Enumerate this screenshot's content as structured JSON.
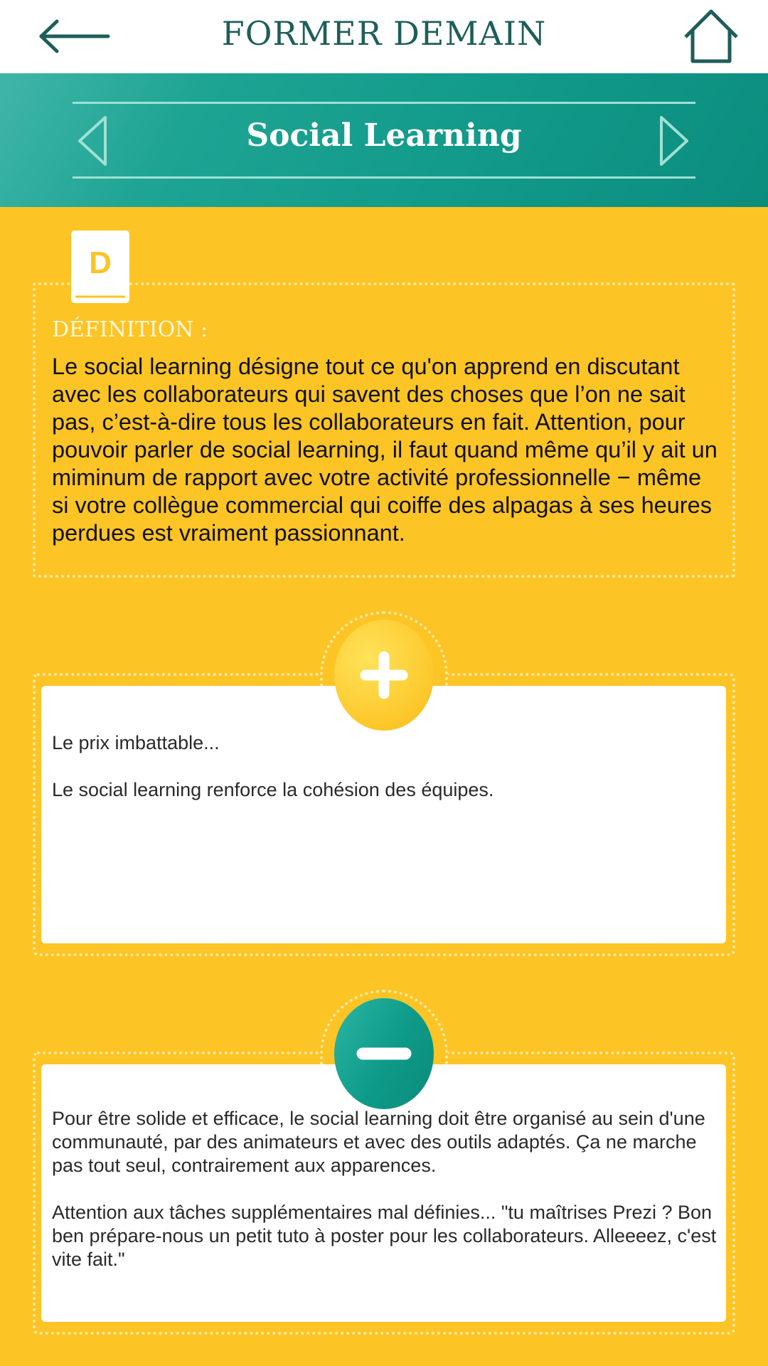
{
  "header": {
    "app_title": "FORMER DEMAIN",
    "back_icon": "arrow-left-icon",
    "home_icon": "home-icon"
  },
  "banner": {
    "title": "Social Learning",
    "prev_icon": "chevron-left-icon",
    "next_icon": "chevron-right-icon"
  },
  "definition": {
    "icon": "book-icon",
    "icon_letter": "D",
    "label": "DÉFINITION :",
    "text": "Le social learning désigne tout ce qu'on apprend en discutant avec les collaborateurs qui savent des choses que l’on ne sait pas, c’est-à-dire tous les collaborateurs en fait. Attention, pour pouvoir parler de social learning, il faut quand même qu’il y ait un miminum de rapport avec votre activité professionnelle − même si votre collègue commercial qui coiffe des alpagas à ses heures perdues est vraiment passionnant."
  },
  "pros": {
    "icon": "plus-icon",
    "paragraphs": [
      "Le prix imbattable...",
      "Le social learning renforce la cohésion des équipes."
    ]
  },
  "cons": {
    "icon": "minus-icon",
    "paragraphs": [
      "Pour être solide et efficace, le social learning doit être organisé au sein d'une communauté, par des animateurs et avec des outils adaptés. Ça ne marche pas tout seul, contrairement aux apparences.",
      "Attention aux tâches supplémentaires mal définies... \"tu maîtrises Prezi ? Bon ben prépare-nous un petit tuto à poster pour les collaborateurs. Alleeeez, c'est vite fait.\""
    ]
  },
  "colors": {
    "teal": "#129a8a",
    "yellow": "#fdc425",
    "title_green": "#1e5e58"
  }
}
